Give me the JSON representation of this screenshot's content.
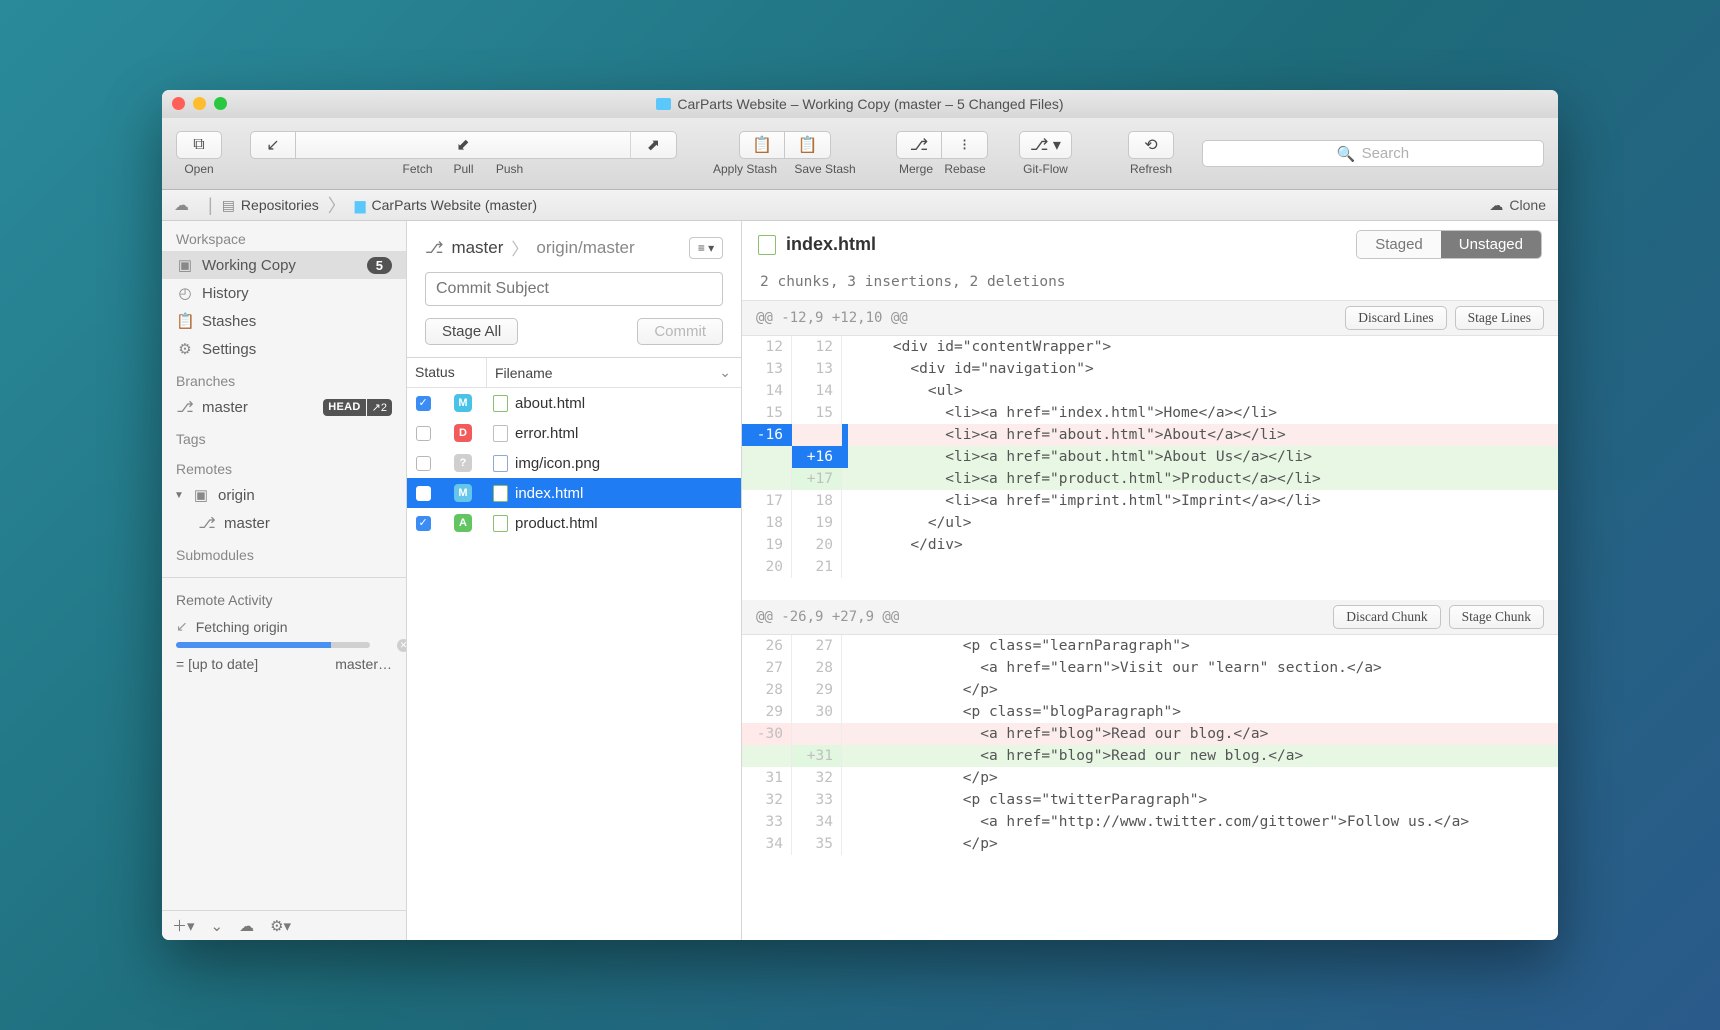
{
  "window": {
    "title": "CarParts Website – Working Copy (master – 5 Changed Files)"
  },
  "toolbar": {
    "open": "Open",
    "fetch": "Fetch",
    "pull": "Pull",
    "push": "Push",
    "apply_stash": "Apply Stash",
    "save_stash": "Save Stash",
    "merge": "Merge",
    "rebase": "Rebase",
    "gitflow": "Git-Flow",
    "refresh": "Refresh",
    "search_placeholder": "Search"
  },
  "breadcrumb": {
    "repositories": "Repositories",
    "repo": "CarParts Website (master)",
    "clone": "Clone"
  },
  "sidebar": {
    "workspace_title": "Workspace",
    "working_copy": "Working Copy",
    "working_copy_count": "5",
    "history": "History",
    "stashes": "Stashes",
    "settings": "Settings",
    "branches_title": "Branches",
    "branch_master": "master",
    "branch_head_badge": "HEAD",
    "branch_ahead": "↗2",
    "tags_title": "Tags",
    "remotes_title": "Remotes",
    "remote_origin": "origin",
    "remote_origin_master": "master",
    "submodules_title": "Submodules",
    "remote_activity_title": "Remote Activity",
    "fetching_origin": "Fetching origin",
    "up_to_date": "= [up to date]",
    "master_trunc": "master…"
  },
  "mid": {
    "branch": "master",
    "tracking": "origin/master",
    "commit_placeholder": "Commit Subject",
    "stage_all": "Stage All",
    "commit": "Commit",
    "col_status": "Status",
    "col_filename": "Filename",
    "files": [
      {
        "checked": true,
        "status": "M",
        "statusClass": "st-M",
        "ico": "html",
        "name": "about.html"
      },
      {
        "checked": false,
        "status": "D",
        "statusClass": "st-D",
        "ico": "file",
        "name": "error.html"
      },
      {
        "checked": false,
        "status": "?",
        "statusClass": "st-Q",
        "ico": "img",
        "name": "img/icon.png"
      },
      {
        "checked": false,
        "status": "M",
        "statusClass": "st-MI",
        "ico": "html",
        "name": "index.html",
        "selected": true
      },
      {
        "checked": true,
        "status": "A",
        "statusClass": "st-A",
        "ico": "html",
        "name": "product.html"
      }
    ]
  },
  "diff": {
    "filename": "index.html",
    "staged_label": "Staged",
    "unstaged_label": "Unstaged",
    "summary": "2 chunks, 3 insertions, 2 deletions",
    "hunk1": {
      "header": "@@ -12,9 +12,10 @@",
      "discard": "Discard Lines",
      "stage": "Stage Lines",
      "rows": [
        {
          "a": "12",
          "b": "12",
          "t": "context",
          "txt": "    <div id=\"contentWrapper\">"
        },
        {
          "a": "13",
          "b": "13",
          "t": "context",
          "txt": "      <div id=\"navigation\">"
        },
        {
          "a": "14",
          "b": "14",
          "t": "context",
          "txt": "        <ul>"
        },
        {
          "a": "15",
          "b": "15",
          "t": "context",
          "txt": "          <li><a href=\"index.html\">Home</a></li>"
        },
        {
          "a": "-16",
          "b": "",
          "t": "del-sel",
          "txt": "          <li><a href=\"about.html\">About</a></li>"
        },
        {
          "a": "",
          "b": "+16",
          "t": "add-sel",
          "txt": "          <li><a href=\"about.html\">About Us</a></li>"
        },
        {
          "a": "",
          "b": "+17",
          "t": "add",
          "txt": "          <li><a href=\"product.html\">Product</a></li>"
        },
        {
          "a": "17",
          "b": "18",
          "t": "context",
          "txt": "          <li><a href=\"imprint.html\">Imprint</a></li>"
        },
        {
          "a": "18",
          "b": "19",
          "t": "context",
          "txt": "        </ul>"
        },
        {
          "a": "19",
          "b": "20",
          "t": "context",
          "txt": "      </div>"
        },
        {
          "a": "20",
          "b": "21",
          "t": "context",
          "txt": ""
        }
      ]
    },
    "hunk2": {
      "header": "@@ -26,9 +27,9 @@",
      "discard": "Discard Chunk",
      "stage": "Stage Chunk",
      "rows": [
        {
          "a": "26",
          "b": "27",
          "t": "context",
          "txt": "            <p class=\"learnParagraph\">"
        },
        {
          "a": "27",
          "b": "28",
          "t": "context",
          "txt": "              <a href=\"learn\">Visit our \"learn\" section.</a>"
        },
        {
          "a": "28",
          "b": "29",
          "t": "context",
          "txt": "            </p>"
        },
        {
          "a": "29",
          "b": "30",
          "t": "context",
          "txt": "            <p class=\"blogParagraph\">"
        },
        {
          "a": "-30",
          "b": "",
          "t": "del",
          "txt": "              <a href=\"blog\">Read our blog.</a>"
        },
        {
          "a": "",
          "b": "+31",
          "t": "add",
          "txt": "              <a href=\"blog\">Read our new blog.</a>"
        },
        {
          "a": "31",
          "b": "32",
          "t": "context",
          "txt": "            </p>"
        },
        {
          "a": "32",
          "b": "33",
          "t": "context",
          "txt": "            <p class=\"twitterParagraph\">"
        },
        {
          "a": "33",
          "b": "34",
          "t": "context",
          "txt": "              <a href=\"http://www.twitter.com/gittower\">Follow us.</a>"
        },
        {
          "a": "34",
          "b": "35",
          "t": "context",
          "txt": "            </p>"
        }
      ]
    }
  }
}
